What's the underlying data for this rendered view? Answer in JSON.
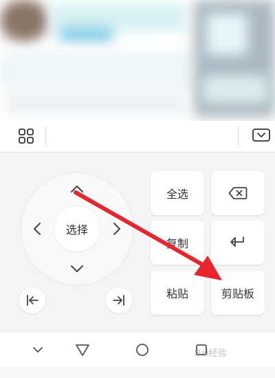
{
  "keyboard": {
    "toolbar": {
      "grid_icon": "grid-icon",
      "collapse_icon": "keyboard-collapse-icon"
    },
    "dpad": {
      "center_label": "选择",
      "up_icon": "chevron-up-icon",
      "down_icon": "chevron-down-icon",
      "left_icon": "chevron-left-icon",
      "right_icon": "chevron-right-icon"
    },
    "line_start_icon": "line-start-icon",
    "line_end_icon": "line-end-icon",
    "keys": {
      "select_all": "全选",
      "copy": "复制",
      "paste": "粘贴",
      "clipboard": "剪贴板",
      "delete_icon": "backspace-icon",
      "enter_icon": "enter-icon"
    }
  },
  "navbar": {
    "hide_keyboard_icon": "chevron-down-icon",
    "back_icon": "triangle-back-icon",
    "home_icon": "circle-home-icon",
    "recent_icon": "square-recent-icon"
  },
  "watermark": {
    "text": "Bai经验"
  },
  "annotation": {
    "color": "#e8242c"
  }
}
